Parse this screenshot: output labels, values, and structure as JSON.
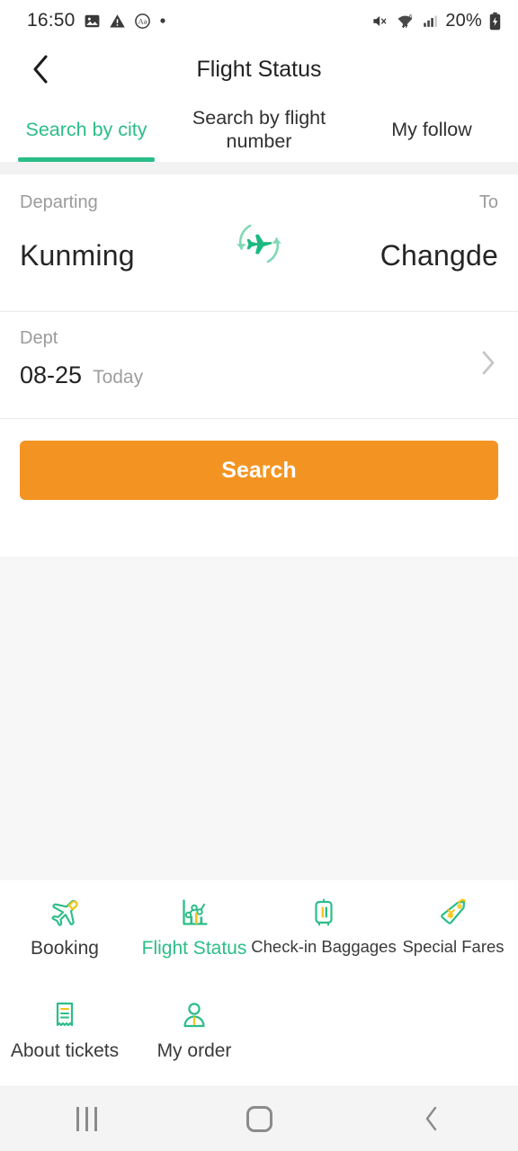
{
  "status_bar": {
    "time": "16:50",
    "battery_percent": "20%",
    "left_icons": [
      "image-icon",
      "warning-icon",
      "font-size-icon",
      "dot-icon"
    ],
    "right_icons": [
      "mute-icon",
      "wifi-icon",
      "cellular-signal-icon",
      "battery-charging-icon"
    ]
  },
  "header": {
    "title": "Flight Status",
    "back_icon": "chevron-left-icon"
  },
  "tabs": [
    {
      "label": "Search by city",
      "active": true
    },
    {
      "label": "Search by flight number",
      "active": false
    },
    {
      "label": "My follow",
      "active": false
    }
  ],
  "route": {
    "departing_label": "Departing",
    "departing_city": "Kunming",
    "to_label": "To",
    "to_city": "Changde",
    "swap_icon": "swap-airplane-icon"
  },
  "date": {
    "label": "Dept",
    "value": "08-25",
    "relative": "Today",
    "chevron_icon": "chevron-right-icon"
  },
  "actions": {
    "search_label": "Search"
  },
  "bottom_grid": [
    {
      "label": "Booking",
      "icon": "airplane-icon",
      "active": false
    },
    {
      "label": "Flight Status",
      "icon": "chart-icon",
      "active": true
    },
    {
      "label": "Check-in Baggages",
      "icon": "suitcase-icon",
      "active": false
    },
    {
      "label": "Special Fares",
      "icon": "price-tag-icon",
      "active": false
    },
    {
      "label": "About tickets",
      "icon": "receipt-icon",
      "active": false
    },
    {
      "label": "My order",
      "icon": "person-icon",
      "active": false
    }
  ],
  "system_nav": {
    "recents": "recents-icon",
    "home": "home-icon",
    "back": "back-icon"
  },
  "colors": {
    "accent_green": "#2bbd87",
    "accent_orange": "#f39422",
    "icon_yellow": "#f5c518",
    "text_dark": "#222222",
    "text_muted": "#9b9b9b"
  }
}
